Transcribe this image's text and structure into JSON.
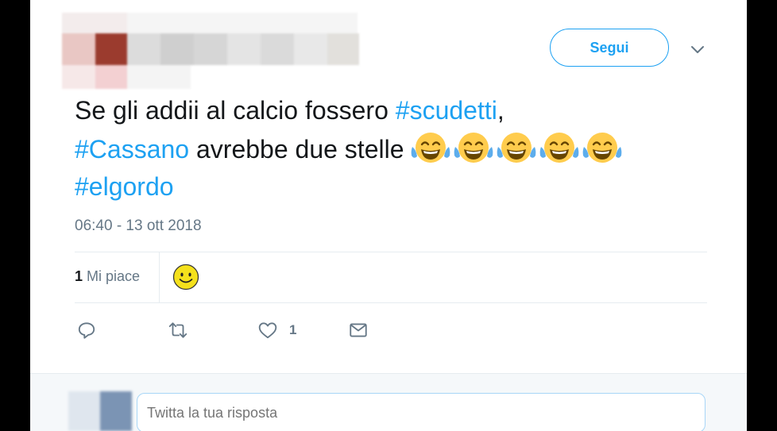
{
  "header": {
    "follow_label": "Segui",
    "menu_icon": "chevron-down-icon"
  },
  "tweet": {
    "text_line1_plain": "Se gli addii al calcio fossero ",
    "hashtag1": "#scudetti",
    "text_line1_end": ",",
    "hashtag2": "#Cassano",
    "text_line2_plain": " avrebbe due stelle ",
    "emoji_name": "face-with-tears-of-joy-icon",
    "emoji_count": 5,
    "hashtag3": "#elgordo",
    "timestamp": "06:40 - 13 ott 2018"
  },
  "stats": {
    "likes_count": "1",
    "likes_label": " Mi piace"
  },
  "actions": {
    "reply_icon": "reply-icon",
    "retweet_icon": "retweet-icon",
    "like_icon": "heart-icon",
    "like_count": "1",
    "dm_icon": "envelope-icon"
  },
  "reply": {
    "placeholder": "Twitta la tua risposta"
  },
  "colors": {
    "accent": "#1da1f2",
    "text": "#14171a",
    "muted": "#657786"
  }
}
